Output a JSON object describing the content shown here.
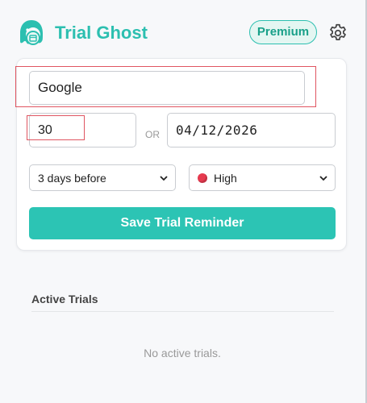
{
  "app": {
    "title": "Trial Ghost",
    "premium_label": "Premium",
    "logo_icon": "ghost-logo-icon",
    "settings_icon": "gear-icon"
  },
  "form": {
    "service_value": "Google",
    "days_value": "30",
    "or_label": "OR",
    "date_value": "04/12/2026",
    "remind_selected": "3 days before",
    "priority_selected": "High",
    "priority_color": "#e63a4f",
    "save_label": "Save Trial Reminder"
  },
  "active": {
    "heading": "Active Trials",
    "empty_text": "No active trials."
  },
  "colors": {
    "accent": "#2cbfb0",
    "highlight": "#e05561"
  }
}
